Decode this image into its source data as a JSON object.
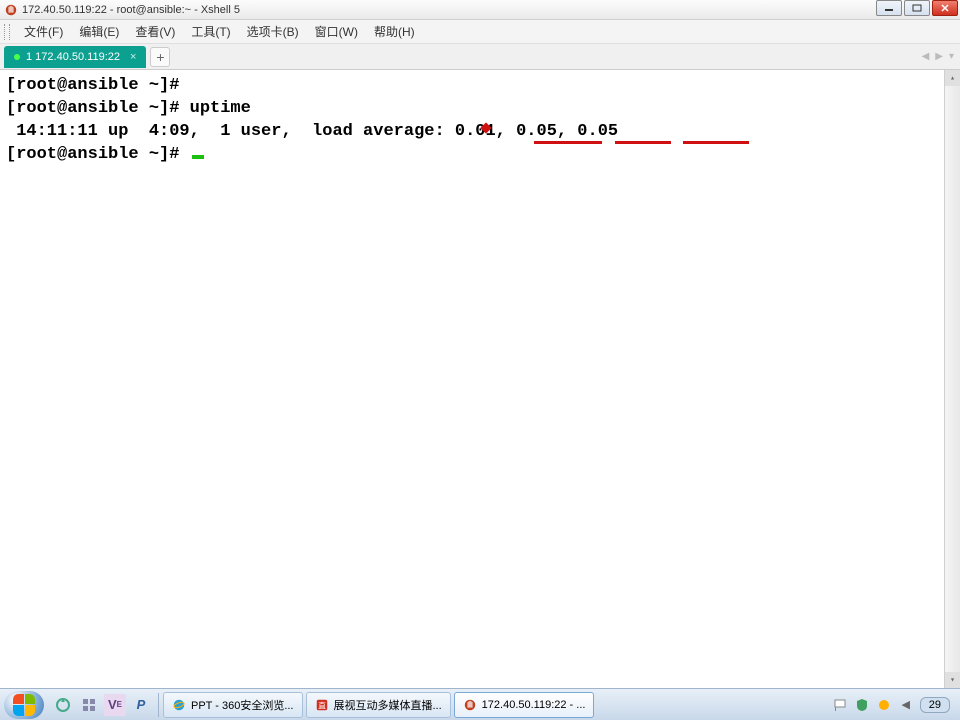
{
  "window": {
    "title": "172.40.50.119:22 - root@ansible:~ - Xshell 5"
  },
  "menu": {
    "file": "文件(F)",
    "edit": "编辑(E)",
    "view": "查看(V)",
    "tools": "工具(T)",
    "tabs": "选项卡(B)",
    "window": "窗口(W)",
    "help": "帮助(H)"
  },
  "tabs": {
    "items": [
      {
        "label": "1 172.40.50.119:22"
      }
    ],
    "add_label": "+"
  },
  "terminal": {
    "lines": [
      "[root@ansible ~]# ",
      "[root@ansible ~]# uptime",
      " 14:11:11 up  4:09,  1 user,  load average: 0.01, 0.05, 0.05",
      "[root@ansible ~]# "
    ]
  },
  "taskbar": {
    "quicklaunch": [
      "recycle-icon",
      "grid-icon",
      "ve-icon",
      "p-icon"
    ],
    "tasks": [
      {
        "label": "PPT - 360安全浏览...",
        "icon": "ie",
        "icon_color": "#2aa0d8"
      },
      {
        "label": "展视互动多媒体直播...",
        "icon": "app",
        "icon_color": "#d03020"
      },
      {
        "label": "172.40.50.119:22 - ...",
        "icon": "xshell",
        "icon_color": "#c04020",
        "active": true
      }
    ],
    "tray_count": "29",
    "time": "29"
  }
}
